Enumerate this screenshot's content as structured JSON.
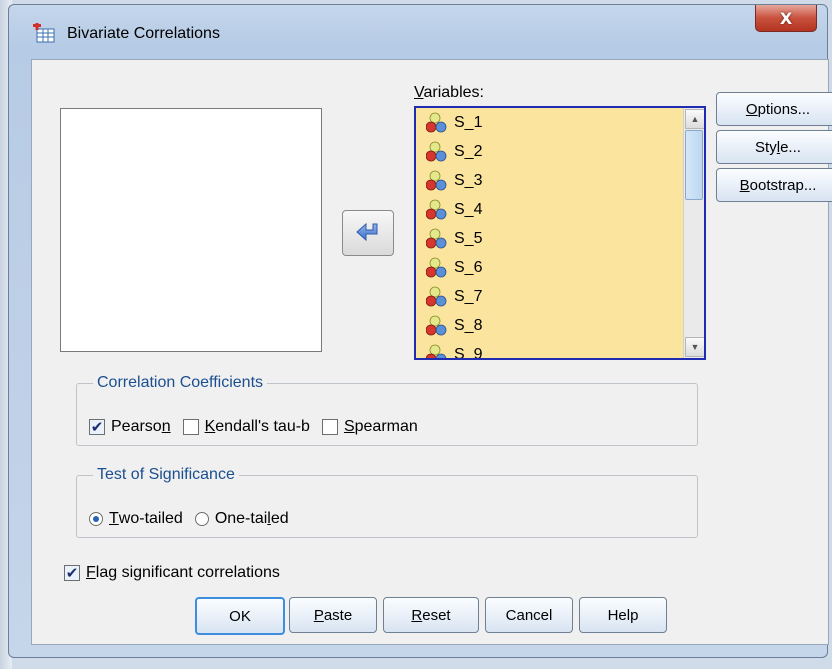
{
  "window": {
    "title": "Bivariate Correlations",
    "close_glyph": "X"
  },
  "variables": {
    "label_underlined": "V",
    "label_rest": "ariables:",
    "items": [
      "S_1",
      "S_2",
      "S_3",
      "S_4",
      "S_5",
      "S_6",
      "S_7",
      "S_8",
      "S_9"
    ],
    "icon": "scale-variable-icon"
  },
  "side_buttons": {
    "options": {
      "ul": "O",
      "rest": "ptions..."
    },
    "style": {
      "pre": "Sty",
      "ul": "l",
      "rest": "e..."
    },
    "bootstrap": {
      "ul": "B",
      "rest": "ootstrap..."
    }
  },
  "correlation": {
    "legend": "Correlation Coefficients",
    "pearson": {
      "pre": "Pearso",
      "ul": "n",
      "rest": "",
      "checked": true
    },
    "kendall": {
      "pre": "",
      "ul": "K",
      "rest": "endall's tau-b",
      "checked": false
    },
    "spearman": {
      "pre": "",
      "ul": "S",
      "rest": "pearman",
      "checked": false
    }
  },
  "significance": {
    "legend": "Test of Significance",
    "two_tailed": {
      "pre": "",
      "ul": "T",
      "rest": "wo-tailed",
      "selected": true
    },
    "one_tailed": {
      "pre": "One-tai",
      "ul": "l",
      "rest": "ed",
      "selected": false
    }
  },
  "flag": {
    "pre": "",
    "ul": "F",
    "rest": "lag significant correlations",
    "checked": true
  },
  "buttons": {
    "ok": "OK",
    "paste": {
      "ul": "P",
      "rest": "aste"
    },
    "reset": {
      "ul": "R",
      "rest": "eset"
    },
    "cancel": "Cancel",
    "help": "Help"
  },
  "colors": {
    "var_list_bg": "#fbe59e",
    "var_list_border": "#1f2bb0",
    "legend_text": "#1b4f8f"
  }
}
